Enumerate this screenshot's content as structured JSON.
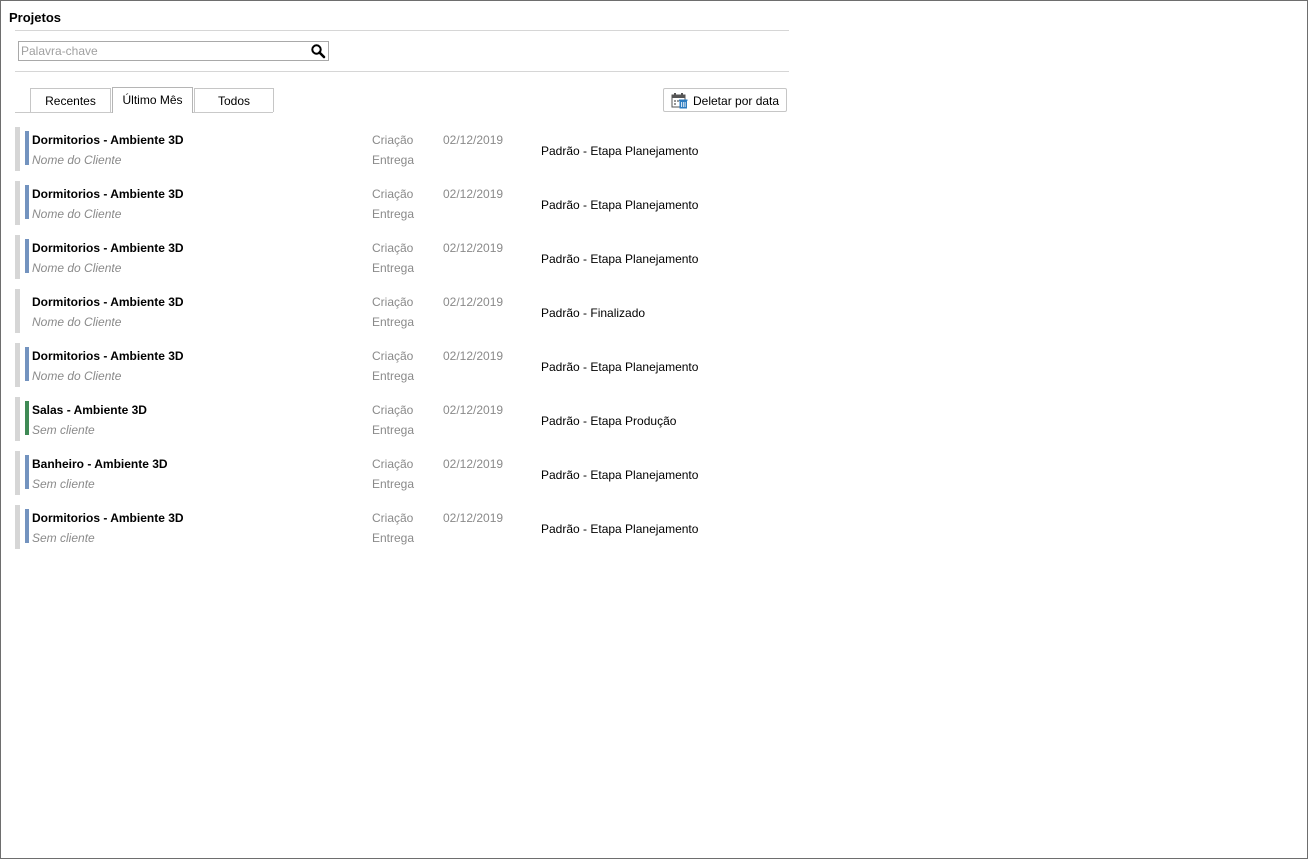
{
  "header": {
    "title": "Projetos"
  },
  "search": {
    "placeholder": "Palavra-chave",
    "value": ""
  },
  "tabs": [
    {
      "label": "Recentes",
      "active": false
    },
    {
      "label": "Último Mês",
      "active": true
    },
    {
      "label": "Todos",
      "active": false
    }
  ],
  "toolbar": {
    "delete_by_date_label": "Deletar por data"
  },
  "colors": {
    "planning": "#7393bf",
    "production": "#3f8a55",
    "none": "transparent",
    "gutter": "#d6d6d6"
  },
  "projects": [
    {
      "name": "Dormitorios - Ambiente 3D",
      "client": "Nome do Cliente",
      "created_label": "Criação",
      "delivery_label": "Entrega",
      "date": "02/12/2019",
      "status": "Padrão - Etapa Planejamento",
      "accent": "planning"
    },
    {
      "name": "Dormitorios - Ambiente 3D",
      "client": "Nome do Cliente",
      "created_label": "Criação",
      "delivery_label": "Entrega",
      "date": "02/12/2019",
      "status": "Padrão - Etapa Planejamento",
      "accent": "planning"
    },
    {
      "name": "Dormitorios - Ambiente 3D",
      "client": "Nome do Cliente",
      "created_label": "Criação",
      "delivery_label": "Entrega",
      "date": "02/12/2019",
      "status": "Padrão - Etapa Planejamento",
      "accent": "planning"
    },
    {
      "name": "Dormitorios - Ambiente 3D",
      "client": "Nome do Cliente",
      "created_label": "Criação",
      "delivery_label": "Entrega",
      "date": "02/12/2019",
      "status": "Padrão - Finalizado",
      "accent": "none"
    },
    {
      "name": "Dormitorios - Ambiente 3D",
      "client": "Nome do Cliente",
      "created_label": "Criação",
      "delivery_label": "Entrega",
      "date": "02/12/2019",
      "status": "Padrão - Etapa Planejamento",
      "accent": "planning"
    },
    {
      "name": "Salas - Ambiente 3D",
      "client": "Sem cliente",
      "created_label": "Criação",
      "delivery_label": "Entrega",
      "date": "02/12/2019",
      "status": "Padrão - Etapa Produção",
      "accent": "production"
    },
    {
      "name": "Banheiro - Ambiente 3D",
      "client": "Sem cliente",
      "created_label": "Criação",
      "delivery_label": "Entrega",
      "date": "02/12/2019",
      "status": "Padrão - Etapa Planejamento",
      "accent": "planning"
    },
    {
      "name": "Dormitorios - Ambiente 3D",
      "client": "Sem cliente",
      "created_label": "Criação",
      "delivery_label": "Entrega",
      "date": "02/12/2019",
      "status": "Padrão - Etapa Planejamento",
      "accent": "planning"
    }
  ]
}
